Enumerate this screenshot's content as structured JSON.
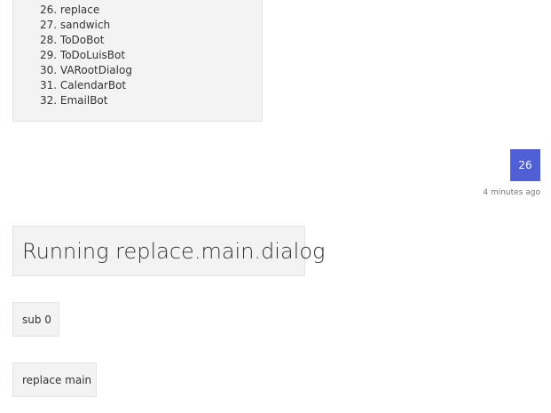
{
  "list_card": {
    "items": [
      "26. replace",
      "27. sandwich",
      "28. ToDoBot",
      "29. ToDoLuisBot",
      "30. VARootDialog",
      "31. CalendarBot",
      "32. EmailBot"
    ]
  },
  "user_message": {
    "text": "26",
    "timestamp": "4 minutes ago",
    "color": "#4f5fd6"
  },
  "bot_messages": {
    "title": "Running replace.main.dialog",
    "sub": "sub 0",
    "replace": "replace main"
  }
}
